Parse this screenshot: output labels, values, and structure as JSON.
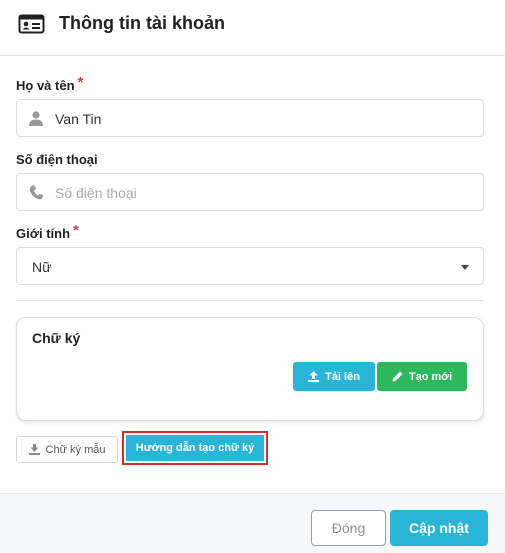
{
  "header": {
    "title": "Thông tin tài khoản",
    "icon": "id-card-icon"
  },
  "form": {
    "name": {
      "label": "Họ và tên",
      "required_mark": "*",
      "value": "Van Tin",
      "icon": "user-icon"
    },
    "phone": {
      "label": "Số điện thoại",
      "placeholder": "Số điện thoại",
      "icon": "phone-icon"
    },
    "gender": {
      "label": "Giới tính",
      "required_mark": "*",
      "selected": "Nữ"
    }
  },
  "signature": {
    "title": "Chữ ký",
    "upload_label": "Tải lên",
    "create_label": "Tạo mới",
    "sample_label": "Chữ ký mẫu",
    "guide_label": "Hướng dẫn tạo chữ ký"
  },
  "footer": {
    "close_label": "Đóng",
    "update_label": "Cập nhật"
  },
  "colors": {
    "accent": "#29b6d6",
    "success": "#2db85c",
    "required": "#e53935",
    "highlight": "#d32f2f"
  }
}
